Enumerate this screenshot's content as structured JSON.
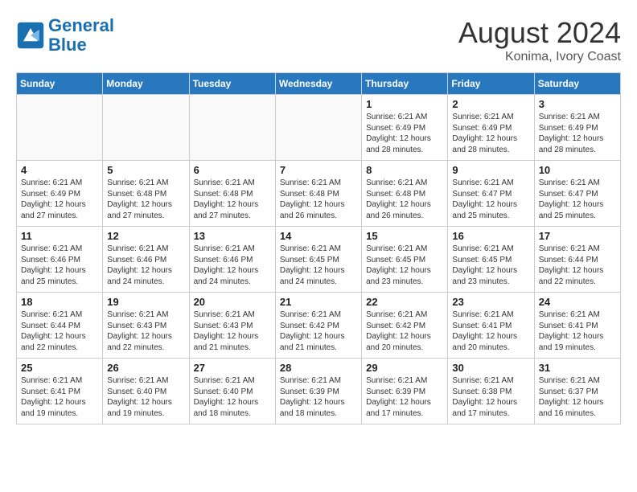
{
  "header": {
    "logo_line1": "General",
    "logo_line2": "Blue",
    "month_year": "August 2024",
    "location": "Konima, Ivory Coast"
  },
  "days_of_week": [
    "Sunday",
    "Monday",
    "Tuesday",
    "Wednesday",
    "Thursday",
    "Friday",
    "Saturday"
  ],
  "weeks": [
    [
      {
        "day": "",
        "detail": ""
      },
      {
        "day": "",
        "detail": ""
      },
      {
        "day": "",
        "detail": ""
      },
      {
        "day": "",
        "detail": ""
      },
      {
        "day": "1",
        "detail": "Sunrise: 6:21 AM\nSunset: 6:49 PM\nDaylight: 12 hours\nand 28 minutes."
      },
      {
        "day": "2",
        "detail": "Sunrise: 6:21 AM\nSunset: 6:49 PM\nDaylight: 12 hours\nand 28 minutes."
      },
      {
        "day": "3",
        "detail": "Sunrise: 6:21 AM\nSunset: 6:49 PM\nDaylight: 12 hours\nand 28 minutes."
      }
    ],
    [
      {
        "day": "4",
        "detail": "Sunrise: 6:21 AM\nSunset: 6:49 PM\nDaylight: 12 hours\nand 27 minutes."
      },
      {
        "day": "5",
        "detail": "Sunrise: 6:21 AM\nSunset: 6:48 PM\nDaylight: 12 hours\nand 27 minutes."
      },
      {
        "day": "6",
        "detail": "Sunrise: 6:21 AM\nSunset: 6:48 PM\nDaylight: 12 hours\nand 27 minutes."
      },
      {
        "day": "7",
        "detail": "Sunrise: 6:21 AM\nSunset: 6:48 PM\nDaylight: 12 hours\nand 26 minutes."
      },
      {
        "day": "8",
        "detail": "Sunrise: 6:21 AM\nSunset: 6:48 PM\nDaylight: 12 hours\nand 26 minutes."
      },
      {
        "day": "9",
        "detail": "Sunrise: 6:21 AM\nSunset: 6:47 PM\nDaylight: 12 hours\nand 25 minutes."
      },
      {
        "day": "10",
        "detail": "Sunrise: 6:21 AM\nSunset: 6:47 PM\nDaylight: 12 hours\nand 25 minutes."
      }
    ],
    [
      {
        "day": "11",
        "detail": "Sunrise: 6:21 AM\nSunset: 6:46 PM\nDaylight: 12 hours\nand 25 minutes."
      },
      {
        "day": "12",
        "detail": "Sunrise: 6:21 AM\nSunset: 6:46 PM\nDaylight: 12 hours\nand 24 minutes."
      },
      {
        "day": "13",
        "detail": "Sunrise: 6:21 AM\nSunset: 6:46 PM\nDaylight: 12 hours\nand 24 minutes."
      },
      {
        "day": "14",
        "detail": "Sunrise: 6:21 AM\nSunset: 6:45 PM\nDaylight: 12 hours\nand 24 minutes."
      },
      {
        "day": "15",
        "detail": "Sunrise: 6:21 AM\nSunset: 6:45 PM\nDaylight: 12 hours\nand 23 minutes."
      },
      {
        "day": "16",
        "detail": "Sunrise: 6:21 AM\nSunset: 6:45 PM\nDaylight: 12 hours\nand 23 minutes."
      },
      {
        "day": "17",
        "detail": "Sunrise: 6:21 AM\nSunset: 6:44 PM\nDaylight: 12 hours\nand 22 minutes."
      }
    ],
    [
      {
        "day": "18",
        "detail": "Sunrise: 6:21 AM\nSunset: 6:44 PM\nDaylight: 12 hours\nand 22 minutes."
      },
      {
        "day": "19",
        "detail": "Sunrise: 6:21 AM\nSunset: 6:43 PM\nDaylight: 12 hours\nand 22 minutes."
      },
      {
        "day": "20",
        "detail": "Sunrise: 6:21 AM\nSunset: 6:43 PM\nDaylight: 12 hours\nand 21 minutes."
      },
      {
        "day": "21",
        "detail": "Sunrise: 6:21 AM\nSunset: 6:42 PM\nDaylight: 12 hours\nand 21 minutes."
      },
      {
        "day": "22",
        "detail": "Sunrise: 6:21 AM\nSunset: 6:42 PM\nDaylight: 12 hours\nand 20 minutes."
      },
      {
        "day": "23",
        "detail": "Sunrise: 6:21 AM\nSunset: 6:41 PM\nDaylight: 12 hours\nand 20 minutes."
      },
      {
        "day": "24",
        "detail": "Sunrise: 6:21 AM\nSunset: 6:41 PM\nDaylight: 12 hours\nand 19 minutes."
      }
    ],
    [
      {
        "day": "25",
        "detail": "Sunrise: 6:21 AM\nSunset: 6:41 PM\nDaylight: 12 hours\nand 19 minutes."
      },
      {
        "day": "26",
        "detail": "Sunrise: 6:21 AM\nSunset: 6:40 PM\nDaylight: 12 hours\nand 19 minutes."
      },
      {
        "day": "27",
        "detail": "Sunrise: 6:21 AM\nSunset: 6:40 PM\nDaylight: 12 hours\nand 18 minutes."
      },
      {
        "day": "28",
        "detail": "Sunrise: 6:21 AM\nSunset: 6:39 PM\nDaylight: 12 hours\nand 18 minutes."
      },
      {
        "day": "29",
        "detail": "Sunrise: 6:21 AM\nSunset: 6:39 PM\nDaylight: 12 hours\nand 17 minutes."
      },
      {
        "day": "30",
        "detail": "Sunrise: 6:21 AM\nSunset: 6:38 PM\nDaylight: 12 hours\nand 17 minutes."
      },
      {
        "day": "31",
        "detail": "Sunrise: 6:21 AM\nSunset: 6:37 PM\nDaylight: 12 hours\nand 16 minutes."
      }
    ]
  ]
}
